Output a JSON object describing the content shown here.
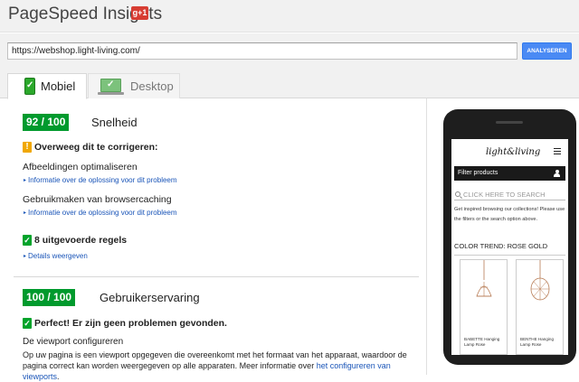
{
  "app": {
    "title": "PageSpeed Insights",
    "gplus_label": "g+1"
  },
  "url_bar": {
    "value": "https://webshop.light-living.com/",
    "button_label": "ANALYSEREN"
  },
  "tabs": [
    {
      "label": "Mobiel",
      "active": true,
      "icon": "mobile-phone-check-icon"
    },
    {
      "label": "Desktop",
      "active": false,
      "icon": "desktop-monitor-check-icon"
    }
  ],
  "speed": {
    "score": "92 / 100",
    "label": "Snelheid",
    "warning_heading": "Overweeg dit te corrigeren:",
    "rules": [
      {
        "title": "Afbeeldingen optimaliseren",
        "link": "Informatie over de oplossing voor dit probleem"
      },
      {
        "title": "Gebruikmaken van browsercaching",
        "link": "Informatie over de oplossing voor dit probleem"
      }
    ],
    "passed_heading": "8 uitgevoerde regels",
    "details_link": "Details weergeven"
  },
  "ux": {
    "score": "100 / 100",
    "label": "Gebruikerservaring",
    "perfect_heading": "Perfect! Er zijn geen problemen gevonden.",
    "rule_title": "De viewport configureren",
    "paragraph_text": "Op uw pagina is een viewport opgegeven die overeenkomt met het formaat van het apparaat, waardoor de pagina correct kan worden weergegeven op alle apparaten. Meer informatie over ",
    "paragraph_link": "het configureren van viewports",
    "paragraph_end": "."
  },
  "preview": {
    "logo": "light&living",
    "filter_label": "Filter products",
    "search_placeholder": "CLICK HERE TO SEARCH",
    "intro_text": "Get inspired browsing our collections! Please use the filters or the search option above.",
    "trend_heading": "COLOR TREND: ROSE GOLD",
    "products": [
      {
        "name": "BABETTE Hanging Lamp Rose"
      },
      {
        "name": "BENTHE Hanging Lamp Rose"
      }
    ]
  },
  "colors": {
    "score_green": "#009a2d",
    "warning_orange": "#f0a700",
    "link_blue": "#1a55b8",
    "button_blue": "#4a8af4"
  }
}
